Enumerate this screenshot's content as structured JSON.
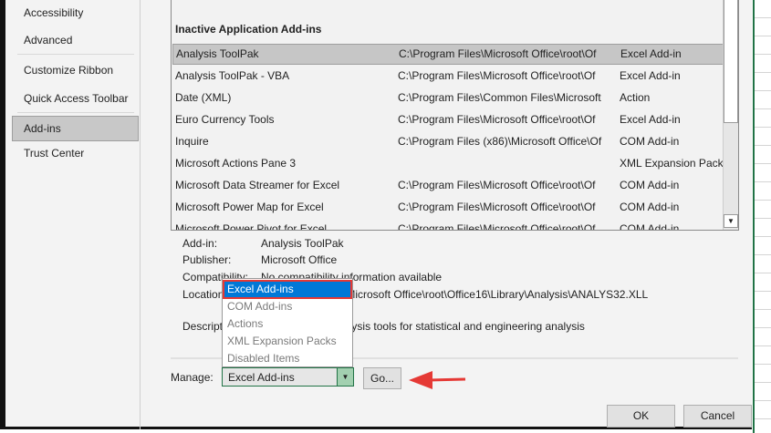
{
  "sidebar": {
    "items": [
      {
        "label": "Accessibility"
      },
      {
        "label": "Advanced"
      },
      {
        "label": "Customize Ribbon"
      },
      {
        "label": "Quick Access Toolbar"
      },
      {
        "label": "Add-ins",
        "selected": true
      },
      {
        "label": "Trust Center"
      }
    ]
  },
  "list": {
    "group": "Inactive Application Add-ins",
    "rows": [
      {
        "name": "Analysis ToolPak",
        "location": "C:\\Program Files\\Microsoft Office\\root\\Of",
        "type": "Excel Add-in"
      },
      {
        "name": "Analysis ToolPak - VBA",
        "location": "C:\\Program Files\\Microsoft Office\\root\\Of",
        "type": "Excel Add-in"
      },
      {
        "name": "Date (XML)",
        "location": "C:\\Program Files\\Common Files\\Microsoft",
        "type": "Action"
      },
      {
        "name": "Euro Currency Tools",
        "location": "C:\\Program Files\\Microsoft Office\\root\\Of",
        "type": "Excel Add-in"
      },
      {
        "name": "Inquire",
        "location": "C:\\Program Files (x86)\\Microsoft Office\\Of",
        "type": "COM Add-in"
      },
      {
        "name": "Microsoft Actions Pane 3",
        "location": "",
        "type": "XML Expansion Pack"
      },
      {
        "name": "Microsoft Data Streamer for Excel",
        "location": "C:\\Program Files\\Microsoft Office\\root\\Of",
        "type": "COM Add-in"
      },
      {
        "name": "Microsoft Power Map for Excel",
        "location": "C:\\Program Files\\Microsoft Office\\root\\Of",
        "type": "COM Add-in"
      },
      {
        "name": "Microsoft Power Pivot for Excel",
        "location": "C:\\Program Files\\Microsoft Office\\root\\Of",
        "type": "COM Add-in"
      }
    ]
  },
  "details": {
    "addin_label": "Add-in:",
    "addin_value": "Analysis ToolPak",
    "publisher_label": "Publisher:",
    "publisher_value": "Microsoft Office",
    "compat_label": "Compatibility:",
    "compat_value": "No compatibility information available",
    "location_label": "Location:",
    "location_value": "C:\\Program Files\\Microsoft Office\\root\\Office16\\Library\\Analysis\\ANALYS32.XLL",
    "desc_label": "Description:",
    "desc_value": "Provides data analysis tools for statistical and engineering analysis"
  },
  "manage": {
    "label": "Manage:",
    "selected": "Excel Add-ins",
    "options": [
      "Excel Add-ins",
      "COM Add-ins",
      "Actions",
      "XML Expansion Packs",
      "Disabled Items"
    ],
    "go_label": "Go..."
  },
  "footer": {
    "ok_label": "OK",
    "cancel_label": "Cancel"
  },
  "colors": {
    "highlight": "#0078d7",
    "annotation": "#e53935",
    "excel_green": "#217346"
  }
}
